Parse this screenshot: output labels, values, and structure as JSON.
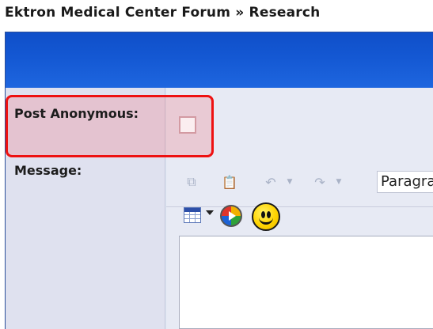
{
  "breadcrumb": {
    "text": "Ektron Medical Center Forum » Research"
  },
  "form": {
    "post_anonymous_label": "Post Anonymous:",
    "message_label": "Message:"
  },
  "toolbar": {
    "items": [
      "copy-icon",
      "paste-icon",
      "undo-icon",
      "redo-icon"
    ],
    "paragraph_select_value": "Paragraph"
  },
  "toolbar2": {
    "items": [
      "insert-table-icon",
      "media-icon",
      "smiley-icon"
    ]
  },
  "colors": {
    "header_blue": "#1458d3",
    "highlight_red": "#ee1111",
    "panel_bg": "#dfe1ef"
  }
}
